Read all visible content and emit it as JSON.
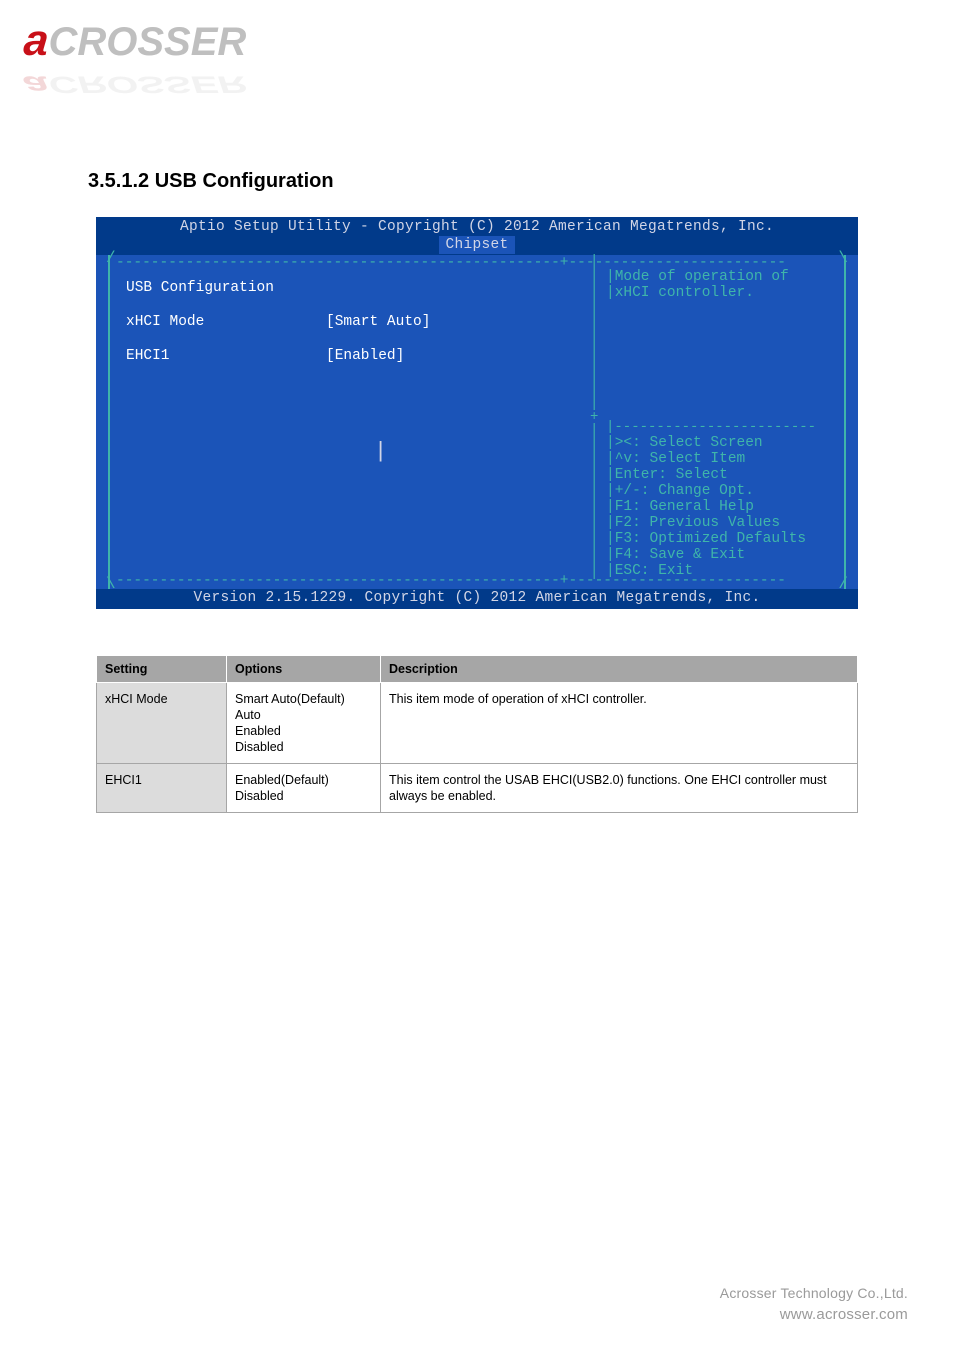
{
  "logo": {
    "text_first": "a",
    "text_rest": "CROSSER"
  },
  "heading": "3.5.1.2 USB Configuration",
  "bios": {
    "title_line1": "Aptio Setup Utility - Copyright (C) 2012 American Megatrends, Inc.",
    "title_line2": "Chipset",
    "section_title": "USB Configuration",
    "rows": [
      {
        "label": "xHCI Mode",
        "value": "[Smart Auto]",
        "highlight": true
      },
      {
        "label": "EHCI1",
        "value": "[Enabled]",
        "highlight": false
      }
    ],
    "hint_line1": "Mode of operation of",
    "hint_line2": "xHCI controller.",
    "help": [
      "><: Select Screen",
      "^v: Select Item",
      "Enter: Select",
      "+/-: Change Opt.",
      "F1: General Help",
      "F2: Previous Values",
      "F3: Optimized Defaults",
      "F4: Save & Exit",
      "ESC: Exit"
    ],
    "footer": "Version 2.15.1229. Copyright (C) 2012 American Megatrends, Inc."
  },
  "table": {
    "headers": [
      "Setting",
      "Options",
      "Description"
    ],
    "rows": [
      {
        "setting": "xHCI Mode",
        "options": "Smart Auto(Default)\nAuto\nEnabled\nDisabled",
        "description": "This item mode of operation of xHCI controller."
      },
      {
        "setting": "EHCI1",
        "options": "Enabled(Default)\nDisabled",
        "description": "This item control the USAB EHCI(USB2.0) functions. One EHCI controller must always be enabled."
      }
    ]
  },
  "footer": {
    "line1": "Acrosser Technology Co.,Ltd.",
    "line2": "www.acrosser.com"
  }
}
